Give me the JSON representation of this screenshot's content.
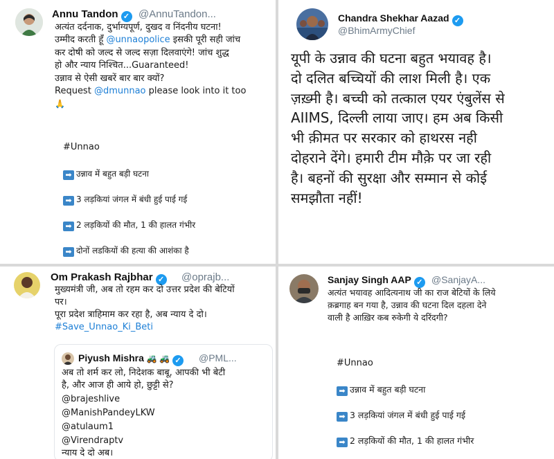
{
  "tweets": {
    "annu": {
      "name": "Annu Tandon",
      "handle": "@AnnuTandon...",
      "lines": [
        "अत्यंत दर्दनाक, दुर्भाग्यपूर्ण, दुखद व निंदनीय घटना!",
        "उम्मीद करती हूँ @unnaopolice इसकी पूरी सही जांच",
        "कर दोषी को जल्द से जल्द सज़ा दिलवाएंगे! जांच शुद्ध",
        "हो और न्याय निश्चित...Guaranteed!",
        "उन्नाव से ऐसी खबरें बार बार क्यों?",
        "Request @dmunnao please look into it too",
        "🙏"
      ],
      "hashtag": "#Unnao",
      "bullets": [
        "उन्नाव में बहुत बड़ी घटना",
        "3 लड़कियां जंगल में बंधी हुई पाई गई",
        "2 लड़कियों की मौत, 1 की हालत गंभीर",
        "दोनों लडकियों की हत्या की आशंका है"
      ]
    },
    "chandra": {
      "name": "Chandra Shekhar Aazad",
      "handle": "@BhimArmyChief",
      "lines": [
        "यूपी के उन्नाव की घटना बहुत भयावह है।",
        "दो दलित बच्चियों की लाश मिली है। एक",
        "ज़ख़्मी है। बच्ची को तत्काल एयर एंबुलेंस से",
        "AIIMS, दिल्ली लाया जाए। हम अब किसी",
        "भी क़ीमत पर सरकार को हाथरस नही",
        "दोहराने देंगे। हमारी टीम मौक़े पर जा रही",
        "है। बहनों की सुरक्षा और सम्मान से कोई",
        "समझौता नहीं!"
      ]
    },
    "om": {
      "name": "Om Prakash Rajbhar",
      "handle": "@oprajb...",
      "lines": [
        "मुख्यमंत्री जी, अब तो रहम कर दो उत्तर प्रदेश की बेटियों",
        "पर।",
        "पूरा प्रदेश त्राहिमाम कर रहा है, अब न्याय दे दो।",
        "#Save_Unnao_Ki_Beti"
      ],
      "quote": {
        "name": "Piyush Mishra",
        "emoji": "🚜 🚜",
        "handle": "@PML...",
        "lines": [
          "अब तो शर्म कर लो, निदेशक बाबू, आपकी भी बेटी",
          "है, और आज ही आये हो, छुट्टी से?",
          "@brajeshlive",
          "@ManishPandeyLKW",
          "@atulaum1",
          "@Virendraptv",
          "न्याय दे दो अब।"
        ]
      }
    },
    "sanjay": {
      "name": "Sanjay Singh AAP",
      "handle": "@SanjayA...",
      "lines": [
        "अत्यंत भयावह आदित्यनाथ जी का राज बेटियों के लिये",
        "क़ब्रगाह बन गया है, उन्नाव की घटना दिल दहला देने",
        "वाली है आख़िर कब रुकेगी ये दरिंदगी?"
      ],
      "hashtag": "#Unnao",
      "bullets": [
        "उन्नाव में बहुत बड़ी घटना",
        "3 लड़कियां जंगल में बंधी हुई पाई गई",
        "2 लड़कियों की मौत, 1 की हालत गंभीर"
      ]
    }
  },
  "icons": {
    "verified": "verified-badge-icon",
    "arrow": "right-arrow-emoji-icon"
  },
  "colors": {
    "verified": "#1d9bf0",
    "link": "#1d7fd6",
    "handle": "#6b7a88"
  }
}
